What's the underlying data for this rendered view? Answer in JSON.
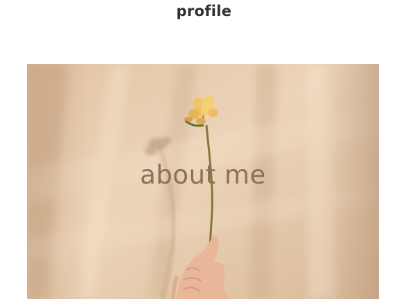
{
  "header": {
    "title": "profile"
  },
  "hero": {
    "heading": "about me",
    "colors": {
      "wall": "#e9d0b4",
      "shadow": "#c9a98a",
      "text": "#8d6f5d",
      "flower": "#f0c56a",
      "stem": "#7f7a3a"
    }
  }
}
